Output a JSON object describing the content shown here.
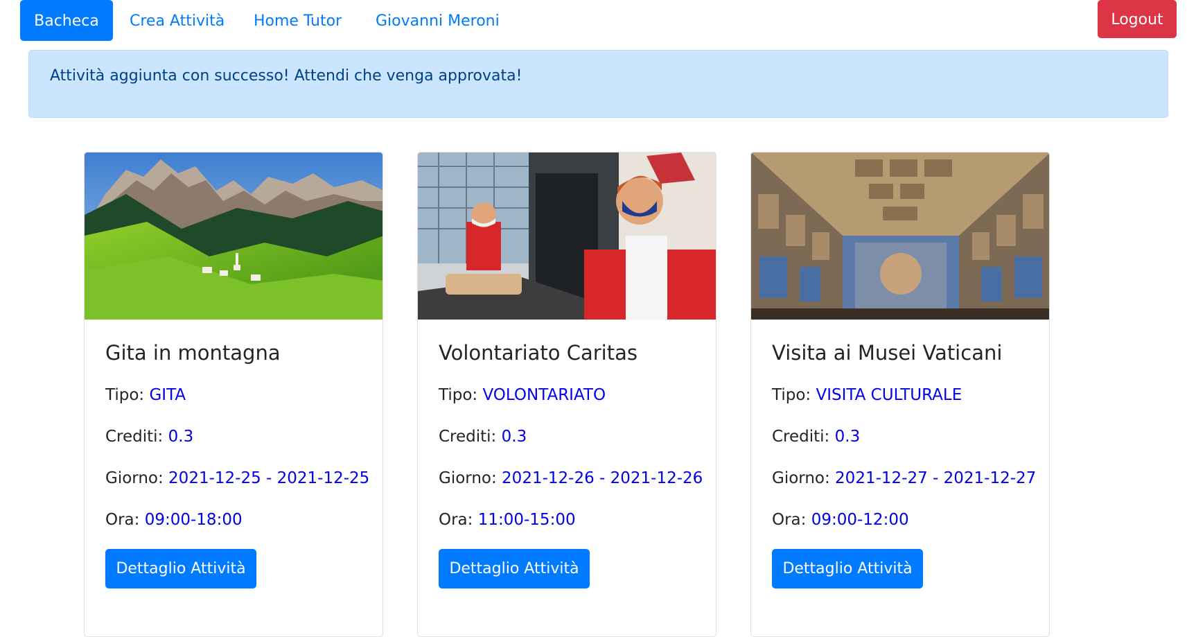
{
  "nav": {
    "items": [
      "Bacheca",
      "Crea Attività",
      "Home Tutor",
      "Giovanni Meroni"
    ],
    "logout": "Logout"
  },
  "alert": {
    "message": "Attività aggiunta con successo! Attendi che venga approvata!"
  },
  "cards": [
    {
      "title": "Gita in montagna",
      "tipo_label": "Tipo:",
      "tipo": "GITA",
      "crediti_label": "Crediti:",
      "crediti": "0.3",
      "giorno_label": "Giorno:",
      "giorno_start": "2021-12-25",
      "giorno_sep": " - ",
      "giorno_end": "2021-12-25",
      "ora_label": "Ora:",
      "ora": "09:00-18:00",
      "button": "Dettaglio Attività"
    },
    {
      "title": "Volontariato Caritas",
      "tipo_label": "Tipo:",
      "tipo": "VOLONTARIATO",
      "crediti_label": "Crediti:",
      "crediti": "0.3",
      "giorno_label": "Giorno:",
      "giorno_start": "2021-12-26",
      "giorno_sep": " - ",
      "giorno_end": "2021-12-26",
      "ora_label": "Ora:",
      "ora": "11:00-15:00",
      "button": "Dettaglio Attività"
    },
    {
      "title": "Visita ai Musei Vaticani",
      "tipo_label": "Tipo:",
      "tipo": "VISITA CULTURALE",
      "crediti_label": "Crediti:",
      "crediti": "0.3",
      "giorno_label": "Giorno:",
      "giorno_start": "2021-12-27",
      "giorno_sep": " - ",
      "giorno_end": "2021-12-27",
      "ora_label": "Ora:",
      "ora": "09:00-12:00",
      "button": "Dettaglio Attività"
    }
  ],
  "colors": {
    "primary": "#007bff",
    "danger": "#dc3545",
    "alert_bg": "#cce5ff",
    "alert_text": "#004085",
    "value_text": "#0000ee"
  }
}
